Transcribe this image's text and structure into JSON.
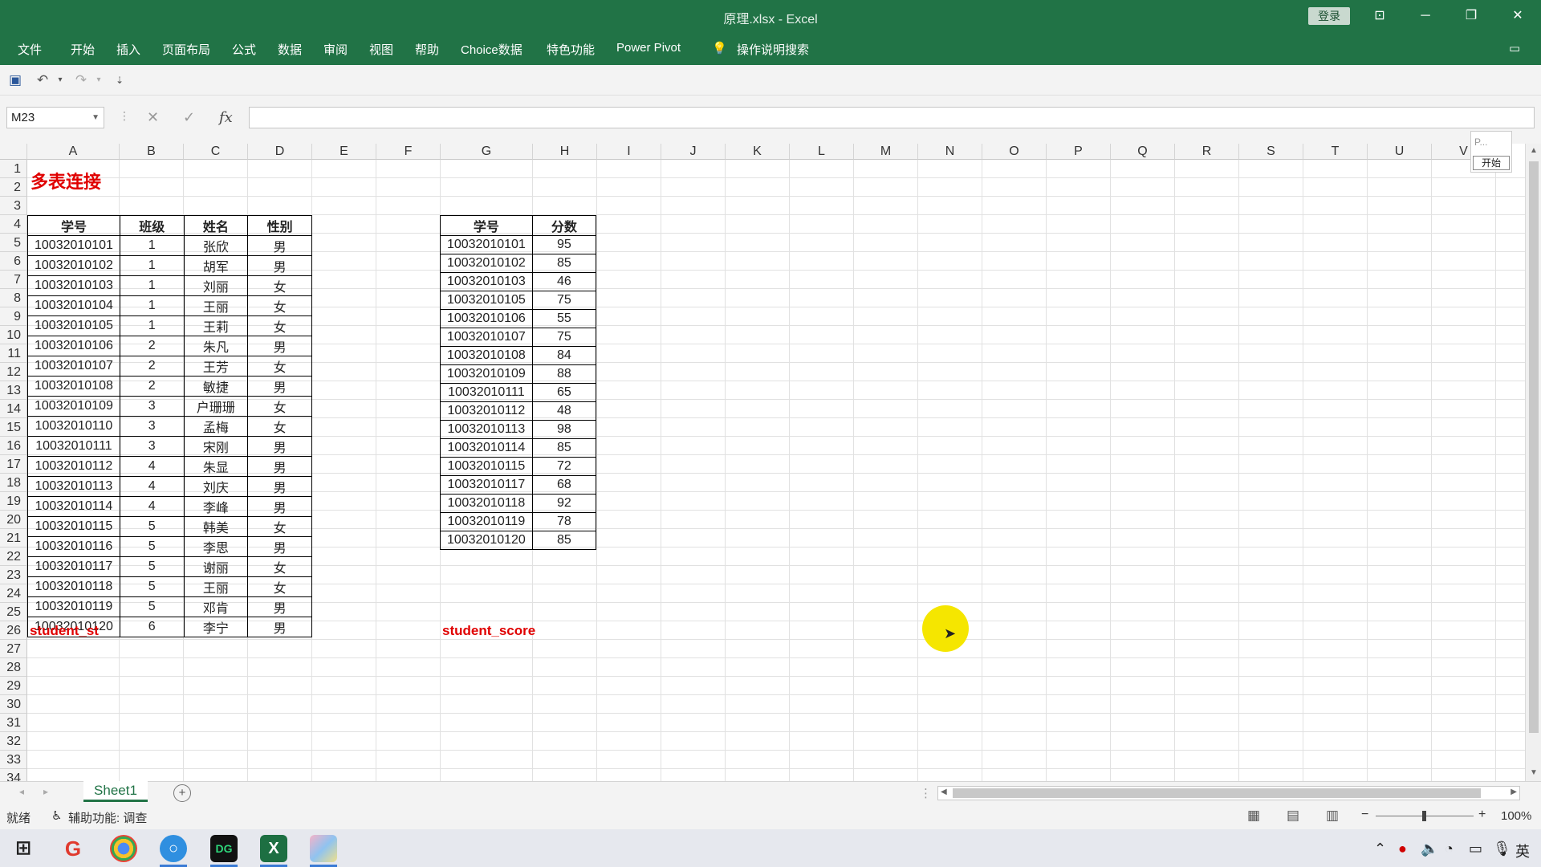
{
  "window": {
    "title": "原理.xlsx  -  Excel",
    "login_label": "登录"
  },
  "ribbon_tabs": [
    "文件",
    "开始",
    "插入",
    "页面布局",
    "公式",
    "数据",
    "审阅",
    "视图",
    "帮助",
    "Choice数据",
    "特色功能",
    "Power Pivot"
  ],
  "tell_me": "操作说明搜索",
  "name_box": "M23",
  "columns": [
    "A",
    "B",
    "C",
    "D",
    "E",
    "F",
    "G",
    "H",
    "I",
    "J",
    "K",
    "L",
    "M",
    "N",
    "O",
    "P",
    "Q",
    "R",
    "S",
    "T",
    "U",
    "V"
  ],
  "rows": [
    "1",
    "2",
    "3",
    "4",
    "5",
    "6",
    "7",
    "8",
    "9",
    "10",
    "11",
    "12",
    "13",
    "14",
    "15",
    "16",
    "17",
    "18",
    "19",
    "20",
    "21",
    "22",
    "23",
    "24",
    "25",
    "26",
    "27",
    "28",
    "29",
    "30",
    "31",
    "32",
    "33",
    "34"
  ],
  "sheet_title": "多表连接",
  "student_st": {
    "label": "student_st",
    "headers": [
      "学号",
      "班级",
      "姓名",
      "性别"
    ],
    "rows": [
      [
        "10032010101",
        "1",
        "张欣",
        "男"
      ],
      [
        "10032010102",
        "1",
        "胡军",
        "男"
      ],
      [
        "10032010103",
        "1",
        "刘丽",
        "女"
      ],
      [
        "10032010104",
        "1",
        "王丽",
        "女"
      ],
      [
        "10032010105",
        "1",
        "王莉",
        "女"
      ],
      [
        "10032010106",
        "2",
        "朱凡",
        "男"
      ],
      [
        "10032010107",
        "2",
        "王芳",
        "女"
      ],
      [
        "10032010108",
        "2",
        "敏捷",
        "男"
      ],
      [
        "10032010109",
        "3",
        "户珊珊",
        "女"
      ],
      [
        "10032010110",
        "3",
        "孟梅",
        "女"
      ],
      [
        "10032010111",
        "3",
        "宋刚",
        "男"
      ],
      [
        "10032010112",
        "4",
        "朱显",
        "男"
      ],
      [
        "10032010113",
        "4",
        "刘庆",
        "男"
      ],
      [
        "10032010114",
        "4",
        "李峰",
        "男"
      ],
      [
        "10032010115",
        "5",
        "韩美",
        "女"
      ],
      [
        "10032010116",
        "5",
        "李思",
        "男"
      ],
      [
        "10032010117",
        "5",
        "谢丽",
        "女"
      ],
      [
        "10032010118",
        "5",
        "王丽",
        "女"
      ],
      [
        "10032010119",
        "5",
        "邓肯",
        "男"
      ],
      [
        "10032010120",
        "6",
        "李宁",
        "男"
      ]
    ]
  },
  "student_score": {
    "label": "student_score",
    "headers": [
      "学号",
      "分数"
    ],
    "rows": [
      [
        "10032010101",
        "95"
      ],
      [
        "10032010102",
        "85"
      ],
      [
        "10032010103",
        "46"
      ],
      [
        "10032010105",
        "75"
      ],
      [
        "10032010106",
        "55"
      ],
      [
        "10032010107",
        "75"
      ],
      [
        "10032010108",
        "84"
      ],
      [
        "10032010109",
        "88"
      ],
      [
        "10032010111",
        "65"
      ],
      [
        "10032010112",
        "48"
      ],
      [
        "10032010113",
        "98"
      ],
      [
        "10032010114",
        "85"
      ],
      [
        "10032010115",
        "72"
      ],
      [
        "10032010117",
        "68"
      ],
      [
        "10032010118",
        "92"
      ],
      [
        "10032010119",
        "78"
      ],
      [
        "10032010120",
        "85"
      ]
    ]
  },
  "mini_box": {
    "text": "P...",
    "button": "开始"
  },
  "sheet_tab": "Sheet1",
  "status": {
    "ready": "就绪",
    "accessibility": "辅助功能: 调查",
    "zoom": "100%"
  },
  "taskbar": {
    "ime": "英"
  }
}
